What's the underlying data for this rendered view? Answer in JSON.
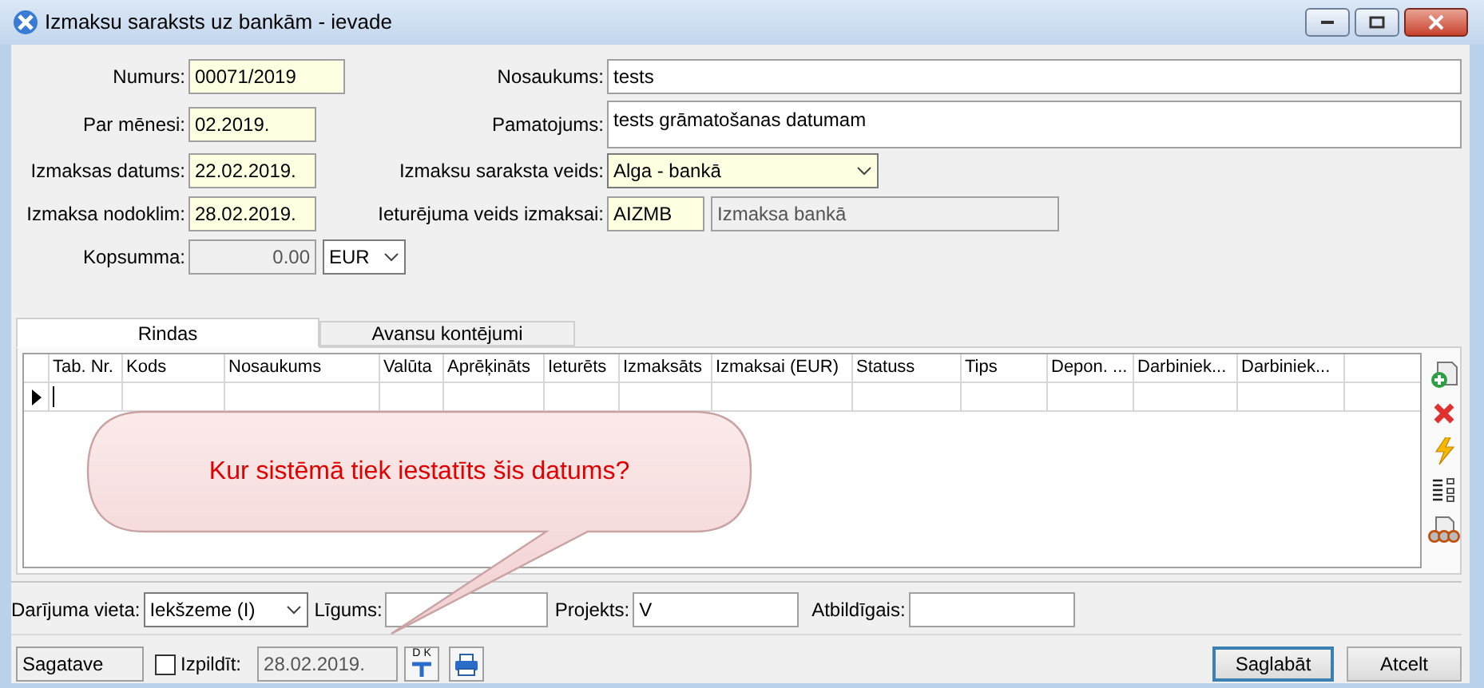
{
  "window": {
    "title": "Izmaksu saraksts uz bankām - ievade"
  },
  "form": {
    "numurs": {
      "label": "Numurs:",
      "value": "00071/2019",
      "required": true,
      "disabled": false
    },
    "par_menesi": {
      "label": "Par mēnesi:",
      "value": "02.2019.",
      "required": true,
      "disabled": false
    },
    "izmaksas_datums": {
      "label": "Izmaksas datums:",
      "value": "22.02.2019.",
      "required": true,
      "disabled": false
    },
    "izmaksa_nodoklim": {
      "label": "Izmaksa nodoklim:",
      "value": "28.02.2019.",
      "required": true,
      "disabled": false
    },
    "kopsumma": {
      "label": "Kopsumma:",
      "value": "0.00",
      "required": false,
      "disabled": true
    },
    "valuta": {
      "value": "EUR",
      "required": false,
      "disabled": false
    },
    "nosaukums": {
      "label": "Nosaukums:",
      "value": "tests",
      "required": false,
      "disabled": false
    },
    "pamatojums": {
      "label": "Pamatojums:",
      "value": "tests grāmatošanas datumam",
      "required": false,
      "disabled": false
    },
    "saraksta_veids": {
      "label": "Izmaksu saraksta veids:",
      "value": "Alga - bankā",
      "required": true,
      "disabled": false
    },
    "ieturejuma_veids": {
      "label": "Ieturējuma veids izmaksai:",
      "value": "AIZMB",
      "required": true,
      "disabled": false
    },
    "ieturejuma_nosaukums": {
      "value": "Izmaksa bankā",
      "required": false,
      "disabled": true
    }
  },
  "tabs": [
    {
      "label": "Rindas",
      "selected": true
    },
    {
      "label": "Avansu kontējumi",
      "selected": false
    }
  ],
  "table": {
    "columns": [
      "Tab. Nr.",
      "Kods",
      "Nosaukums",
      "Valūta",
      "Aprēķināts",
      "Ieturēts",
      "Izmaksāts",
      "Izmaksai (EUR)",
      "Statuss",
      "Tips",
      "Depon. ...",
      "Darbiniek...",
      "Darbiniek..."
    ],
    "rows": [
      {
        "current": true
      }
    ]
  },
  "callout": {
    "text": "Kur sistēmā tiek iestatīts šis datums?"
  },
  "bottom": {
    "darijuma_vieta": {
      "label": "Darījuma vieta:",
      "value": "Iekšzeme (I)",
      "required": false,
      "disabled": false
    },
    "ligums": {
      "label": "Līgums:",
      "required": false,
      "disabled": false
    },
    "projekts": {
      "label": "Projekts:",
      "value": "V",
      "required": false,
      "disabled": false
    },
    "atbildigais": {
      "label": "Atbildīgais:",
      "required": false,
      "disabled": false
    }
  },
  "status_bar": {
    "status": "Sagatave",
    "izpildit": {
      "label": "Izpildīt:",
      "checked": false
    },
    "date": {
      "value": "28.02.2019.",
      "required": false,
      "disabled": true
    },
    "dk_letters": [
      "D",
      "K"
    ],
    "buttons": [
      {
        "label": "Saglabāt",
        "default": true
      },
      {
        "label": "Atcelt",
        "default": false
      }
    ]
  }
}
